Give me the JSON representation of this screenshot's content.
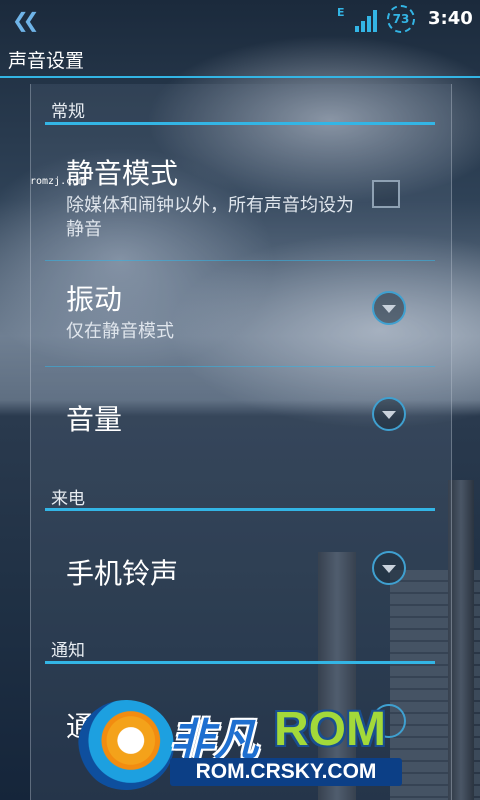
{
  "status_bar": {
    "network_type": "E",
    "battery": "73",
    "time": "3:40",
    "accent": "#33b5e5"
  },
  "title": "声音设置",
  "sections": [
    {
      "category": "常规",
      "items": [
        {
          "title": "静音模式",
          "summary": "除媒体和闹钟以外，所有声音均设为静音",
          "widget": "checkbox",
          "checked": false
        },
        {
          "title": "振动",
          "summary": "仅在静音模式",
          "widget": "dropdown"
        },
        {
          "title": "音量",
          "widget": "dropdown"
        }
      ]
    },
    {
      "category": "来电",
      "items": [
        {
          "title": "手机铃声",
          "widget": "dropdown"
        }
      ]
    },
    {
      "category": "通知",
      "items": [
        {
          "title": "通",
          "widget": "dropdown"
        }
      ]
    }
  ],
  "watermarks": {
    "site_small": "romzj.com",
    "logo_cn": "非凡",
    "logo_rom": "ROM",
    "logo_url": "ROM.CRSKY.COM"
  }
}
